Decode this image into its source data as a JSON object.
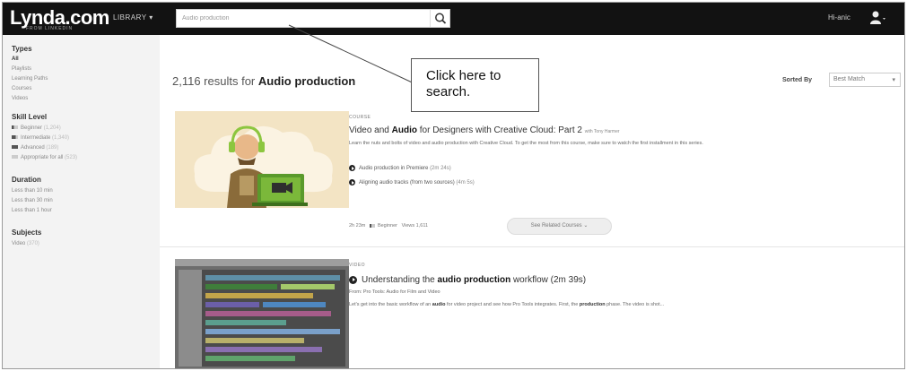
{
  "header": {
    "logo": "Lynda.com",
    "logo_sub": "FROM LINKEDIN",
    "library_label": "LIBRARY",
    "search_value": "Audio production",
    "user_name": "Hi-anic"
  },
  "sidebar": {
    "types_heading": "Types",
    "types": [
      "All",
      "Playlists",
      "Learning Paths",
      "Courses",
      "Videos"
    ],
    "skill_heading": "Skill Level",
    "skills": [
      {
        "label": "Beginner",
        "count": "(1,204)"
      },
      {
        "label": "Intermediate",
        "count": "(1,340)"
      },
      {
        "label": "Advanced",
        "count": "(189)"
      },
      {
        "label": "Appropriate for all",
        "count": "(523)"
      }
    ],
    "duration_heading": "Duration",
    "durations": [
      "Less than 10 min",
      "Less than 30 min",
      "Less than 1 hour"
    ],
    "subjects_heading": "Subjects",
    "subjects": [
      {
        "label": "Video",
        "count": "(370)"
      }
    ]
  },
  "results": {
    "count_text": "2,116 results for",
    "query": "Audio production",
    "sorted_by_label": "Sorted By",
    "sort_value": "Best Match"
  },
  "course": {
    "kind": "COURSE",
    "title_pre": "Video and",
    "title_bold": "Audio",
    "title_post": "for Designers with Creative Cloud: Part 2",
    "author": "with Tony Harmer",
    "description": "Learn the nuts and bolts of video and audio production with Creative Cloud. To get the most from this course, make sure to watch the first installment in this series.",
    "links": [
      {
        "label": "Audio production in Premiere",
        "duration": "(2m 24s)"
      },
      {
        "label": "Aligning audio tracks (from two sources)",
        "duration": "(4m 5s)"
      }
    ],
    "length": "2h 23m",
    "level": "Beginner",
    "views": "Views 1,611",
    "related_button": "See Related Courses"
  },
  "video": {
    "kind": "VIDEO",
    "title_pre": "Understanding the",
    "title_bold": "audio production",
    "title_post": "workflow (2m 39s)",
    "from": "From: Pro Tools: Audio for Film and Video",
    "desc_pre": "Let's get into the basic workflow of an",
    "desc_bold1": "audio",
    "desc_mid": "for video project and see how Pro Tools integrates. First, the",
    "desc_bold2": "production",
    "desc_post": "phase. The video is shot..."
  },
  "callout": {
    "line1": "Click here to",
    "line2": "search."
  }
}
